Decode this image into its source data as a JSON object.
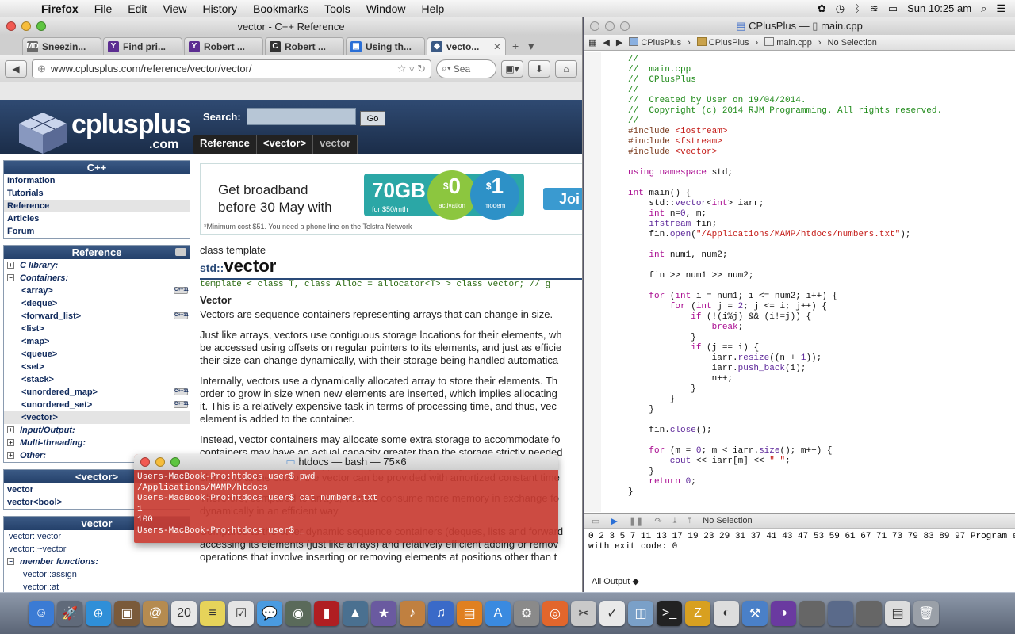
{
  "menubar": {
    "app": "Firefox",
    "items": [
      "File",
      "Edit",
      "View",
      "History",
      "Bookmarks",
      "Tools",
      "Window",
      "Help"
    ],
    "clock": "Sun 10:25 am"
  },
  "firefox": {
    "title": "vector - C++ Reference",
    "tabs": [
      {
        "label": "Sneezin...",
        "color": "#6a6a6a",
        "glyph": "MD"
      },
      {
        "label": "Find pri...",
        "color": "#5c2d91",
        "glyph": "Y"
      },
      {
        "label": "Robert ...",
        "color": "#5c2d91",
        "glyph": "Y"
      },
      {
        "label": "Robert ...",
        "color": "#333333",
        "glyph": "C"
      },
      {
        "label": "Using th...",
        "color": "#2a6fd6",
        "glyph": "▣"
      },
      {
        "label": "vecto...",
        "color": "#3b5a85",
        "glyph": "◆",
        "active": true
      }
    ],
    "url": "www.cplusplus.com/reference/vector/vector/",
    "search_placeholder": "Sea"
  },
  "site": {
    "logo": "cplusplus",
    "logo_com": ".com",
    "search_label": "Search:",
    "go": "Go",
    "crumbs": [
      "Reference",
      "<vector>",
      "vector"
    ]
  },
  "left": {
    "cpp_title": "C++",
    "cpp_items": [
      "Information",
      "Tutorials",
      "Reference",
      "Articles",
      "Forum"
    ],
    "ref_title": "Reference",
    "ref_tree": [
      {
        "label": "C library:",
        "type": "cat",
        "pm": "+"
      },
      {
        "label": "Containers:",
        "type": "cat",
        "pm": "−"
      },
      {
        "label": "<array>",
        "type": "sub",
        "c11": true
      },
      {
        "label": "<deque>",
        "type": "sub"
      },
      {
        "label": "<forward_list>",
        "type": "sub",
        "c11": true
      },
      {
        "label": "<list>",
        "type": "sub"
      },
      {
        "label": "<map>",
        "type": "sub"
      },
      {
        "label": "<queue>",
        "type": "sub"
      },
      {
        "label": "<set>",
        "type": "sub"
      },
      {
        "label": "<stack>",
        "type": "sub"
      },
      {
        "label": "<unordered_map>",
        "type": "sub",
        "c11": true
      },
      {
        "label": "<unordered_set>",
        "type": "sub",
        "c11": true
      },
      {
        "label": "<vector>",
        "type": "sub",
        "sel": true
      },
      {
        "label": "Input/Output:",
        "type": "cat",
        "pm": "+"
      },
      {
        "label": "Multi-threading:",
        "type": "cat",
        "pm": "+"
      },
      {
        "label": "Other:",
        "type": "cat",
        "pm": "+"
      }
    ],
    "vec_title": "<vector>",
    "vec_items": [
      "vector",
      "vector<bool>"
    ],
    "vector_title": "vector",
    "vector_items": [
      "vector::vector",
      "vector::~vector"
    ],
    "member_functions": "member functions:",
    "members": [
      "vector::assign",
      "vector::at",
      "vector::back"
    ]
  },
  "ad": {
    "headline1": "Get broadband",
    "headline2": "before 30 May with",
    "gb": "70GB",
    "gb_sub": "for $50/mth",
    "activation": "0",
    "activation_label": "activation",
    "modem": "1",
    "modem_label": "modem",
    "join": "Joi",
    "fine": "*Minimum cost $51. You need a phone line on the Telstra Network"
  },
  "doc": {
    "class_type": "class template",
    "ns": "std::",
    "name": "vector",
    "template": "template < class T, class Alloc = allocator<T> > class vector; // g",
    "heading": "Vector",
    "p1": "Vectors are sequence containers representing arrays that can change in size.",
    "p2": [
      "Just like arrays, vectors use contiguous storage locations for their elements, wh",
      "be accessed using offsets on regular pointers to its elements, and just as efficie",
      "their size can change dynamically, with their storage being handled automatica"
    ],
    "p3": [
      "Internally, vectors use a dynamically allocated array to store their elements. Th",
      "order to grow in size when new elements are inserted, which implies allocating",
      "it. This is a relatively expensive task in terms of processing time, and thus, vec",
      "element is added to the container."
    ],
    "p4": [
      "Instead, vector containers may allocate some extra storage to accommodate fo",
      "containers may have an actual capacity greater than the storage strictly needed",
      "reallocation should only happen at logarithmically growing intervals of si",
      "elements at the end of the vector can be provided with amortized constant time"
    ],
    "p5": [
      "Therefore, compared to arrays, vectors consume more memory in exchange fo",
      "dynamically in an efficient way."
    ],
    "p6": [
      "Compared to the other dynamic sequence containers (deques, lists and forward",
      "accessing its elements (just like arrays) and relatively efficient adding or remov",
      "operations that involve inserting or removing elements at positions other than t"
    ]
  },
  "terminal": {
    "title": "htdocs — bash — 75×6",
    "lines": [
      "Users-MacBook-Pro:htdocs user$ pwd",
      "/Applications/MAMP/htdocs",
      "Users-MacBook-Pro:htdocs user$ cat numbers.txt",
      "1",
      "100",
      "Users-MacBook-Pro:htdocs user$ _"
    ]
  },
  "xcode": {
    "title_project": "CPlusPlus",
    "title_file": "main.cpp",
    "jump": [
      "CPlusPlus",
      "CPlusPlus",
      "main.cpp",
      "No Selection"
    ],
    "code": [
      [
        [
          "cm",
          "//"
        ]
      ],
      [
        [
          "cm",
          "//  main.cpp"
        ]
      ],
      [
        [
          "cm",
          "//  CPlusPlus"
        ]
      ],
      [
        [
          "cm",
          "//"
        ]
      ],
      [
        [
          "cm",
          "//  Created by User on 19/04/2014."
        ]
      ],
      [
        [
          "cm",
          "//  Copyright (c) 2014 RJM Programming. All rights reserved."
        ]
      ],
      [
        [
          "cm",
          "//"
        ]
      ],
      [
        [
          "pp",
          "#include "
        ],
        [
          "st",
          "<iostream>"
        ]
      ],
      [
        [
          "pp",
          "#include "
        ],
        [
          "st",
          "<fstream>"
        ]
      ],
      [
        [
          "pp",
          "#include "
        ],
        [
          "st",
          "<vector>"
        ]
      ],
      [],
      [
        [
          "kw",
          "using namespace "
        ],
        [
          "",
          "std;"
        ]
      ],
      [],
      [
        [
          "kw",
          "int "
        ],
        [
          "",
          "main() {"
        ]
      ],
      [
        [
          "",
          "    std::"
        ],
        [
          "tp",
          "vector"
        ],
        [
          "",
          "<"
        ],
        [
          "kw",
          "int"
        ],
        [
          "",
          "> iarr;"
        ]
      ],
      [
        [
          "kw",
          "    int "
        ],
        [
          "",
          "n="
        ],
        [
          "tp",
          "0"
        ],
        [
          "",
          ", m;"
        ]
      ],
      [
        [
          "tp",
          "    ifstream "
        ],
        [
          "",
          "fin;"
        ]
      ],
      [
        [
          "",
          "    fin."
        ],
        [
          "tp",
          "open"
        ],
        [
          "",
          "("
        ],
        [
          "st",
          "\"/Applications/MAMP/htdocs/numbers.txt\""
        ],
        [
          "",
          ");"
        ]
      ],
      [],
      [
        [
          "kw",
          "    int "
        ],
        [
          "",
          "num1, num2;"
        ]
      ],
      [],
      [
        [
          "",
          "    fin >> num1 >> num2;"
        ]
      ],
      [],
      [
        [
          "kw",
          "    for "
        ],
        [
          "",
          "("
        ],
        [
          "kw",
          "int "
        ],
        [
          "",
          "i = num1; i <= num2; i++) {"
        ]
      ],
      [
        [
          "kw",
          "        for "
        ],
        [
          "",
          "("
        ],
        [
          "kw",
          "int "
        ],
        [
          "",
          "j = "
        ],
        [
          "tp",
          "2"
        ],
        [
          "",
          "; j <= i; j++) {"
        ]
      ],
      [
        [
          "kw",
          "            if "
        ],
        [
          "",
          "(!(i%j) && (i!=j)) {"
        ]
      ],
      [
        [
          "kw",
          "                break"
        ],
        [
          "",
          ";"
        ]
      ],
      [
        [
          "",
          "            }"
        ]
      ],
      [
        [
          "kw",
          "            if "
        ],
        [
          "",
          "(j == i) {"
        ]
      ],
      [
        [
          "",
          "                iarr."
        ],
        [
          "tp",
          "resize"
        ],
        [
          "",
          "((n + "
        ],
        [
          "tp",
          "1"
        ],
        [
          "",
          "));"
        ]
      ],
      [
        [
          "",
          "                iarr."
        ],
        [
          "tp",
          "push_back"
        ],
        [
          "",
          "(i);"
        ]
      ],
      [
        [
          "",
          "                n++;"
        ]
      ],
      [
        [
          "",
          "            }"
        ]
      ],
      [
        [
          "",
          "        }"
        ]
      ],
      [
        [
          "",
          "    }"
        ]
      ],
      [],
      [
        [
          "",
          "    fin."
        ],
        [
          "tp",
          "close"
        ],
        [
          "",
          "();"
        ]
      ],
      [],
      [
        [
          "kw",
          "    for "
        ],
        [
          "",
          "(m = "
        ],
        [
          "tp",
          "0"
        ],
        [
          "",
          "; m < iarr."
        ],
        [
          "tp",
          "size"
        ],
        [
          "",
          "(); m++) {"
        ]
      ],
      [
        [
          "tp",
          "        cout "
        ],
        [
          "",
          "<< iarr[m] << "
        ],
        [
          "st",
          "\" \""
        ],
        [
          "",
          ";"
        ]
      ],
      [
        [
          "",
          "    }"
        ]
      ],
      [
        [
          "kw",
          "    return "
        ],
        [
          "tp",
          "0"
        ],
        [
          "",
          ";"
        ]
      ],
      [
        [
          "",
          "}"
        ]
      ]
    ],
    "debug_label": "No Selection",
    "output": "0 2 3 5 7 11 13 17 19 23 29 31 37 41 43 47 53 59 61 67 71 73 79 83 89 97 Program e\nwith exit code: 0",
    "all_output": "All Output ◆"
  },
  "dock": [
    {
      "name": "finder-icon",
      "c": "#3b7bd4",
      "g": "☺"
    },
    {
      "name": "launchpad-icon",
      "c": "#606a7a",
      "g": "🚀"
    },
    {
      "name": "safari-icon",
      "c": "#2f8fd8",
      "g": "⊕"
    },
    {
      "name": "photo-icon",
      "c": "#7a5a3a",
      "g": "▣"
    },
    {
      "name": "contacts-icon",
      "c": "#b58b50",
      "g": "@"
    },
    {
      "name": "calendar-icon",
      "c": "#e8e8e8",
      "g": "20"
    },
    {
      "name": "notes-icon",
      "c": "#e6d35a",
      "g": "≡"
    },
    {
      "name": "reminders-icon",
      "c": "#e5e5e5",
      "g": "☑"
    },
    {
      "name": "messages-icon",
      "c": "#4a9be0",
      "g": "💬"
    },
    {
      "name": "facetime-icon",
      "c": "#5a6a5a",
      "g": "◉"
    },
    {
      "name": "photobooth-icon",
      "c": "#b01e22",
      "g": "▮"
    },
    {
      "name": "iphoto-icon",
      "c": "#4a7090",
      "g": "▲"
    },
    {
      "name": "imovie-icon",
      "c": "#6a5aa0",
      "g": "★"
    },
    {
      "name": "garageband-icon",
      "c": "#c08040",
      "g": "♪"
    },
    {
      "name": "itunes-icon",
      "c": "#3a6ac8",
      "g": "♫"
    },
    {
      "name": "ibooks-icon",
      "c": "#e08020",
      "g": "▤"
    },
    {
      "name": "appstore-icon",
      "c": "#3a8ae0",
      "g": "A"
    },
    {
      "name": "preferences-icon",
      "c": "#8a8a8a",
      "g": "⚙"
    },
    {
      "name": "firefox-icon",
      "c": "#e2662c",
      "g": "◎"
    },
    {
      "name": "scissors-icon",
      "c": "#c9c9c9",
      "g": "✂"
    },
    {
      "name": "checklist-icon",
      "c": "#e9e9e9",
      "g": "✓"
    },
    {
      "name": "preview-icon",
      "c": "#7aa0c8",
      "g": "◫"
    },
    {
      "name": "terminal-icon",
      "c": "#222222",
      "g": ">_"
    },
    {
      "name": "filezilla-icon",
      "c": "#d8a020",
      "g": "Z"
    },
    {
      "name": "accessibility-icon",
      "c": "#dddddd",
      "g": "◐"
    },
    {
      "name": "xcode-icon",
      "c": "#4a80c8",
      "g": "⚒"
    },
    {
      "name": "eclipse-icon",
      "c": "#6a3aa0",
      "g": "◑"
    },
    {
      "name": "window1-icon",
      "c": "#666666",
      "g": ""
    },
    {
      "name": "window2-icon",
      "c": "#5a6a8a",
      "g": ""
    },
    {
      "name": "window3-icon",
      "c": "#666666",
      "g": ""
    },
    {
      "name": "docs-icon",
      "c": "#dddddd",
      "g": "▤"
    },
    {
      "name": "trash-icon",
      "c": "#9aa0a8",
      "g": "🗑"
    }
  ]
}
